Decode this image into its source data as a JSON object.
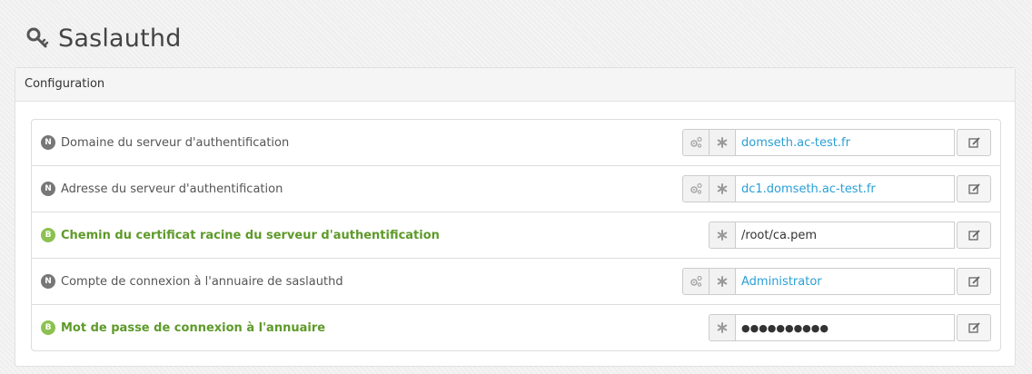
{
  "page": {
    "title": "Saslauthd"
  },
  "panel": {
    "heading": "Configuration"
  },
  "rows": [
    {
      "badge": "N",
      "label": "Domaine du serveur d'authentification",
      "value": "domseth.ac-test.fr",
      "mode": "normal",
      "has_auto_icon": true
    },
    {
      "badge": "N",
      "label": "Adresse du serveur d'authentification",
      "value": "dc1.domseth.ac-test.fr",
      "mode": "normal",
      "has_auto_icon": true
    },
    {
      "badge": "B",
      "label": "Chemin du certificat racine du serveur d'authentification",
      "value": "/root/ca.pem",
      "mode": "basic",
      "has_auto_icon": false
    },
    {
      "badge": "N",
      "label": "Compte de connexion à l'annuaire de saslauthd",
      "value": "Administrator",
      "mode": "normal",
      "has_auto_icon": true
    },
    {
      "badge": "B",
      "label": "Mot de passe de connexion à l'annuaire",
      "value": "●●●●●●●●●●",
      "mode": "basic",
      "has_auto_icon": false
    }
  ],
  "icons": {
    "header": "key-icon",
    "auto": "gears-icon",
    "mandatory": "asterisk-icon",
    "edit": "edit-icon"
  },
  "colors": {
    "normal_badge": "#777777",
    "basic_badge": "#8cc152",
    "basic_label": "#5e9a2a",
    "link_value": "#2a9fd6"
  }
}
